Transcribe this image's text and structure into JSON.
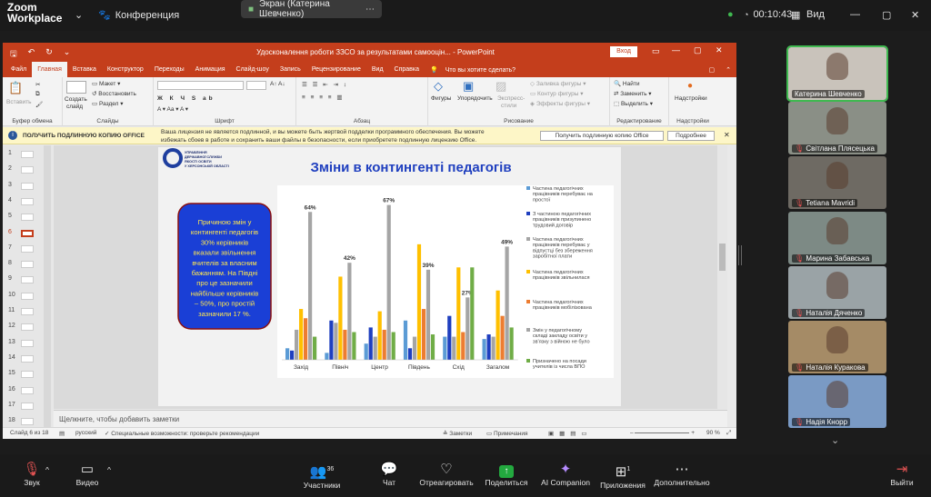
{
  "zoom": {
    "app_name_1": "Zoom",
    "app_name_2": "Workplace",
    "conference_label": "Конференция",
    "share_label": "Экран (Катерина Шевченко)",
    "timer": "00:10:43",
    "view_label": "Вид"
  },
  "ppt": {
    "title": "Удосконалення роботи ЗЗСО за результатами самооцін... - PowerPoint",
    "login_button": "Вход",
    "tabs": [
      "Файл",
      "Главная",
      "Вставка",
      "Конструктор",
      "Переходы",
      "Анимация",
      "Слайд-шоу",
      "Запись",
      "Рецензирование",
      "Вид",
      "Справка",
      "Что вы хотите сделать?"
    ],
    "ribbon": {
      "paste": "Вставить",
      "clipboard": "Буфер обмена",
      "create_slide_1": "Создать",
      "create_slide_2": "слайд",
      "layout": "Макет",
      "restore": "Восстановить",
      "section": "Раздел",
      "slides": "Слайды",
      "font": "Шрифт",
      "paragraph": "Абзац",
      "shapes": "Фигуры",
      "arrange": "Упорядочить",
      "express_1": "Экспресс-",
      "express_2": "стили",
      "fill": "Заливка фигуры",
      "outline": "Контур фигуры",
      "effects": "Эффекты фигуры",
      "drawing": "Рисование",
      "find": "Найти",
      "replace": "Заменить",
      "select": "Выделить",
      "editing": "Редактирование",
      "addins": "Надстройки",
      "addins_group": "Надстройки"
    },
    "warning": {
      "title": "ПОЛУЧИТЬ ПОДЛИННУЮ КОПИЮ OFFICE",
      "text_1": "Ваша лицензия не является подлинной, и вы можете быть жертвой подделки программного обеспечения. Вы можете",
      "text_2": "избежать сбоев в работе и сохранить ваши файлы в безопасности, если приобретете подлинную лицензию Office.",
      "button_1": "Получить подлинную копию Office",
      "button_2": "Подробнее"
    },
    "thumb_numbers": [
      "1",
      "2",
      "3",
      "4",
      "5",
      "6",
      "7",
      "8",
      "9",
      "10",
      "11",
      "12",
      "13",
      "14",
      "15",
      "16",
      "17",
      "18"
    ],
    "notes_placeholder": "Щелкните, чтобы добавить заметки",
    "status": {
      "slide": "Слайд 6 из 18",
      "lang": "русский",
      "access": "Специальные возможности: проверьте рекомендации",
      "notes": "Заметки",
      "comments": "Примечания",
      "zoom": "90 %"
    }
  },
  "slide": {
    "org_1": "УПРАВЛІННЯ",
    "org_2": "ДЕРЖАВНОЇ СЛУЖБИ",
    "org_3": "ЯКОСТІ ОСВІТИ",
    "org_4": "У ХЕРСОНСЬКІЙ ОБЛАСТІ",
    "title": "Зміни в контингенті педагогів",
    "box_lines": [
      "Причиною змін у",
      "контингенті педагогів",
      "30% керівників",
      "вказали звільнення",
      "вчителів за власним",
      "бажанням. На Півдні",
      "про це зазначили",
      "найбільше керівників",
      "– 50%, про простій",
      "зазначили 17 %."
    ]
  },
  "chart_data": {
    "type": "bar",
    "categories": [
      "Захід",
      "Північ",
      "Центр",
      "Південь",
      "Схід",
      "Загалом"
    ],
    "series": [
      {
        "name": "Частина педагогічних працівників перебуває на простої",
        "color": "#5b9bd5",
        "values": [
          5,
          3,
          7,
          17,
          10,
          9
        ]
      },
      {
        "name": "З частиною педагогічних працівників призупинено трудовий договір",
        "color": "#1f3fbf",
        "values": [
          4,
          17,
          14,
          5,
          19,
          11
        ]
      },
      {
        "name": "Частина педагогічних працівників перебуває у відпустці без збереження заробітної плати",
        "color": "#a5a5a5",
        "values": [
          13,
          16,
          10,
          10,
          10,
          10
        ]
      },
      {
        "name": "Частина педагогічних працівників звільнилася",
        "color": "#ffc000",
        "values": [
          22,
          36,
          21,
          50,
          40,
          30
        ]
      },
      {
        "name": "Частина педагогічних працівників мобілізована",
        "color": "#ed7d31",
        "values": [
          18,
          13,
          13,
          22,
          12,
          19
        ]
      },
      {
        "name": "Змін у педагогічному складі закладу освіти у зв’язку з війною не було",
        "color": "#a5a5a5",
        "values": [
          64,
          42,
          67,
          39,
          27,
          49
        ]
      },
      {
        "name": "Призначено на посади учителів із числа ВПО",
        "color": "#70ad47",
        "values": [
          10,
          12,
          12,
          11,
          40,
          14
        ]
      }
    ],
    "data_labels": [
      "64%",
      "42%",
      "67%",
      "39%",
      "27%",
      "49%"
    ],
    "ylim": [
      0,
      70
    ]
  },
  "participants": [
    {
      "name": "Катерина Шевченко",
      "bg": "#c9c3bb"
    },
    {
      "name": "Світлана Плясецька",
      "bg": "#8a8f86"
    },
    {
      "name": "Tetiana Mavridi",
      "bg": "#6e6a63"
    },
    {
      "name": "Марина Забавська",
      "bg": "#7d8a85"
    },
    {
      "name": "Наталія Дяченко",
      "bg": "#9aa3a6"
    },
    {
      "name": "Наталія Куракова",
      "bg": "#a58b66"
    },
    {
      "name": "Надія Кнорр",
      "bg": "#7a9ac4"
    }
  ],
  "bottom_bar": {
    "mic": "Звук",
    "video": "Видео",
    "participants": "Участники",
    "participants_count": "36",
    "chat": "Чат",
    "react": "Отреагировать",
    "share": "Поделиться",
    "companion": "AI Companion",
    "apps": "Приложения",
    "apps_count": "1",
    "more": "Дополнительно",
    "leave": "Выйти"
  }
}
